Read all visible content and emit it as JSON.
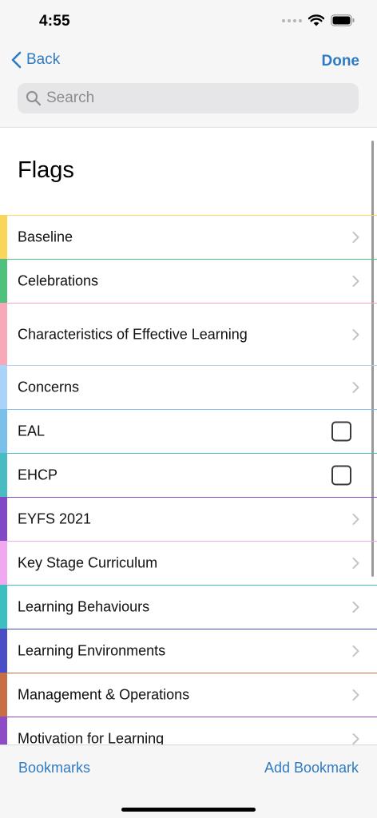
{
  "status_bar": {
    "time": "4:55",
    "icons": [
      "signal-dots-icon",
      "wifi-icon",
      "battery-icon"
    ]
  },
  "nav": {
    "back_label": "Back",
    "back_icon": "chevron-left-icon",
    "done_label": "Done"
  },
  "search": {
    "placeholder": "Search",
    "value": "",
    "icon": "magnifier-icon"
  },
  "page": {
    "title": "Flags"
  },
  "flags": [
    {
      "label": "Baseline",
      "color": "#f9d65b",
      "control": "chevron"
    },
    {
      "label": "Celebrations",
      "color": "#4ec27d",
      "control": "chevron"
    },
    {
      "label": "Characteristics of Effective Learning",
      "color": "#f9a8b8",
      "control": "chevron"
    },
    {
      "label": "Concerns",
      "color": "#a9d3f8",
      "control": "chevron"
    },
    {
      "label": "EAL",
      "color": "#7bc0ea",
      "control": "checkbox",
      "checked": false
    },
    {
      "label": "EHCP",
      "color": "#48bcc0",
      "control": "checkbox",
      "checked": false
    },
    {
      "label": "EYFS 2021",
      "color": "#8047c8",
      "control": "chevron"
    },
    {
      "label": "Key Stage Curriculum",
      "color": "#f1a8f0",
      "control": "chevron"
    },
    {
      "label": "Learning Behaviours",
      "color": "#3cbfbe",
      "control": "chevron"
    },
    {
      "label": "Learning Environments",
      "color": "#4a4ec6",
      "control": "chevron"
    },
    {
      "label": "Management & Operations",
      "color": "#c86e47",
      "control": "chevron"
    },
    {
      "label": "Motivation for Learning",
      "color": "#8f4ac6",
      "control": "chevron"
    }
  ],
  "toolbar": {
    "left_label": "Bookmarks",
    "right_label": "Add Bookmark"
  },
  "colors": {
    "accent": "#2e7bc4",
    "bar_background": "#f6f6f6"
  }
}
